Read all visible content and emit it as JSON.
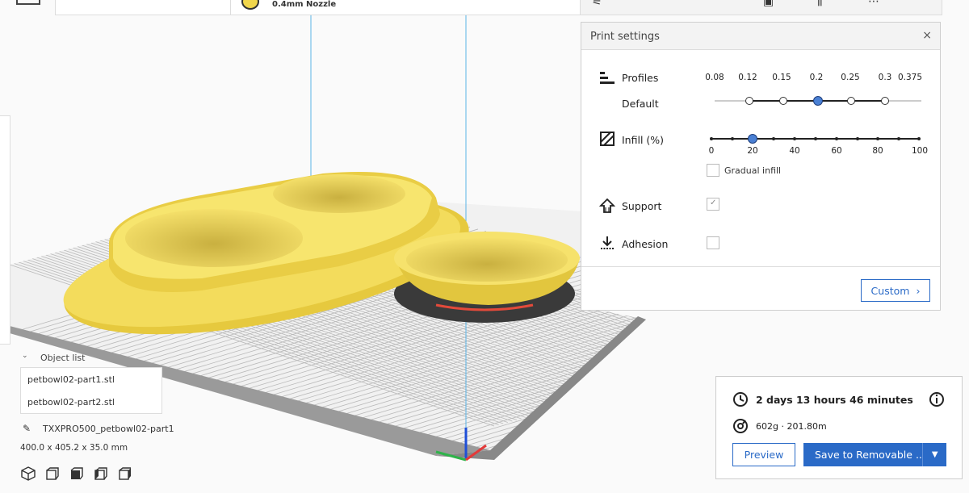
{
  "header": {
    "nozzle": "0.4mm Nozzle"
  },
  "print_settings": {
    "title": "Print settings",
    "close": "×",
    "profiles": {
      "label": "Profiles",
      "current": "Default",
      "options": [
        "0.08",
        "0.12",
        "0.15",
        "0.2",
        "0.25",
        "0.3",
        "0.375"
      ],
      "selected_value": "0.2"
    },
    "infill": {
      "label": "Infill (%)",
      "ticks": [
        "0",
        "20",
        "40",
        "60",
        "80",
        "100"
      ],
      "value_percent": 20,
      "gradual_label": "Gradual infill",
      "gradual_checked": false
    },
    "support": {
      "label": "Support",
      "checked": true
    },
    "adhesion": {
      "label": "Adhesion",
      "checked": false
    },
    "custom_button": "Custom"
  },
  "object_list": {
    "header": "Object list",
    "items": [
      "petbowl02-part1.stl",
      "petbowl02-part2.stl"
    ],
    "selected_name": "TXXPRO500_petbowl02-part1",
    "dimensions": "400.0 x 405.2 x 35.0 mm"
  },
  "estimate": {
    "time": "2 days 13 hours 46 minutes",
    "material": "602g · 201.80m",
    "preview_button": "Preview",
    "save_button": "Save to Removable ..."
  },
  "colors": {
    "accent": "#2a6ac7",
    "model": "#f1d64c",
    "build_plate": "#cfcfcf"
  }
}
